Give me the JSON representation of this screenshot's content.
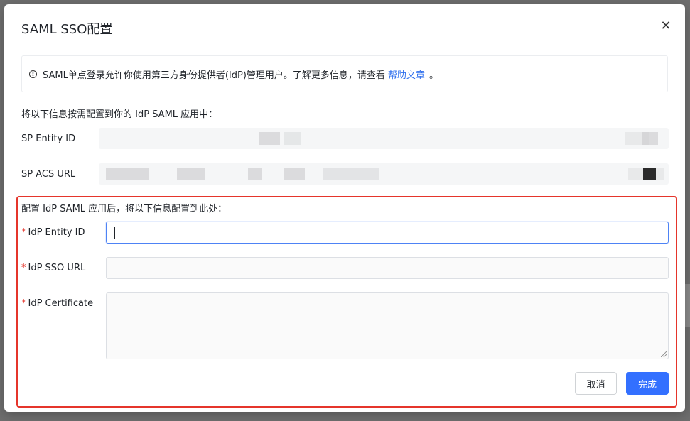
{
  "dialog": {
    "title": "SAML SSO配置",
    "close_icon": "close-icon"
  },
  "notice": {
    "icon": "info-icon",
    "text": "SAML单点登录允许你使用第三方身份提供者(IdP)管理用户。了解更多信息，请查看",
    "link_label": "帮助文章",
    "suffix": "。"
  },
  "sp_section": {
    "heading": "将以下信息按需配置到你的 IdP SAML 应用中：",
    "fields": [
      {
        "label": "SP Entity ID",
        "value": ""
      },
      {
        "label": "SP ACS URL",
        "value": ""
      }
    ]
  },
  "idp_section": {
    "heading": "配置 IdP SAML 应用后，将以下信息配置到此处：",
    "required_mark": "*",
    "fields": [
      {
        "label": "IdP Entity ID",
        "value": "",
        "placeholder": ""
      },
      {
        "label": "IdP SSO URL",
        "value": "",
        "placeholder": ""
      },
      {
        "label": "IdP Certificate",
        "value": "",
        "placeholder": ""
      }
    ]
  },
  "actions": {
    "cancel_label": "取消",
    "done_label": "完成"
  },
  "colors": {
    "primary": "#3370ff",
    "link": "#2f6fed",
    "required": "#e5352b",
    "highlight_border": "#e5352b"
  }
}
